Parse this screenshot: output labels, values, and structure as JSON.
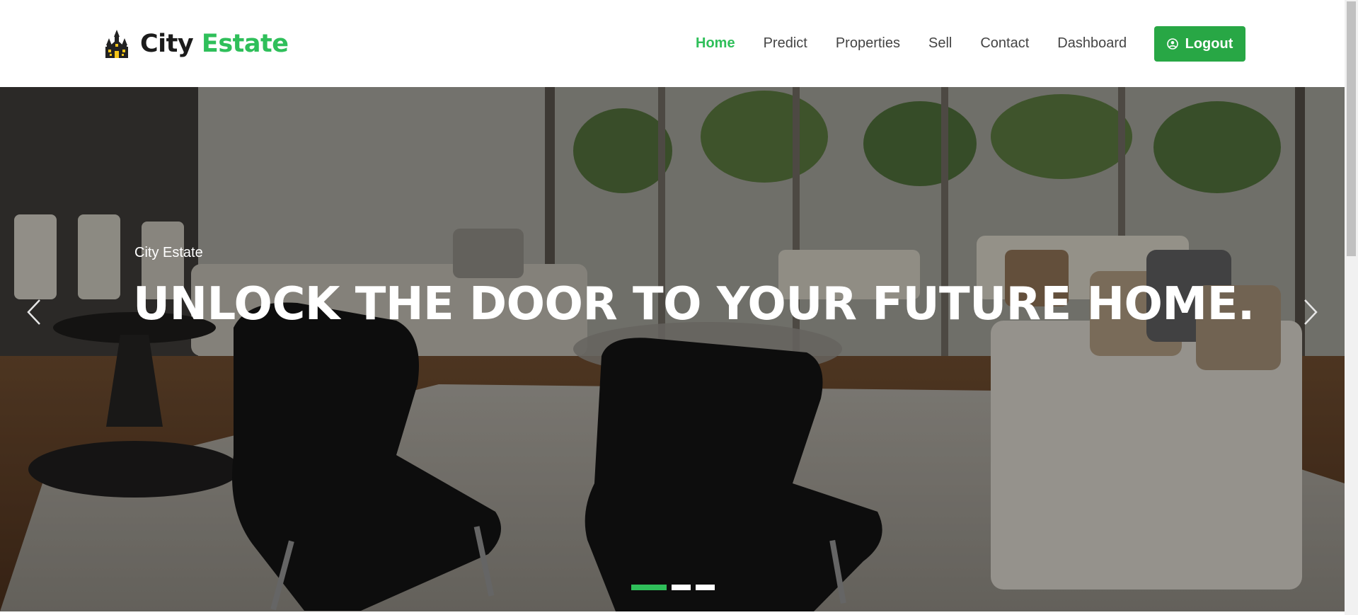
{
  "brand": {
    "name_primary": "City",
    "name_accent": "Estate",
    "logo_icon": "haunted-house-icon",
    "accent_color": "#2fbf5a"
  },
  "nav": {
    "items": [
      {
        "label": "Home",
        "active": true
      },
      {
        "label": "Predict",
        "active": false
      },
      {
        "label": "Properties",
        "active": false
      },
      {
        "label": "Sell",
        "active": false
      },
      {
        "label": "Contact",
        "active": false
      },
      {
        "label": "Dashboard",
        "active": false
      }
    ],
    "logout_label": "Logout",
    "logout_icon": "user-circle-icon",
    "button_color": "#28a745"
  },
  "hero": {
    "kicker": "City Estate",
    "title": "UNLOCK THE DOOR TO YOUR FUTURE HOME.",
    "background_icon": "living-room-photo",
    "prev_icon": "chevron-left-icon",
    "next_icon": "chevron-right-icon",
    "indicators": [
      {
        "active": true
      },
      {
        "active": false
      },
      {
        "active": false
      }
    ],
    "active_slide": 1,
    "slide_count": 3
  }
}
